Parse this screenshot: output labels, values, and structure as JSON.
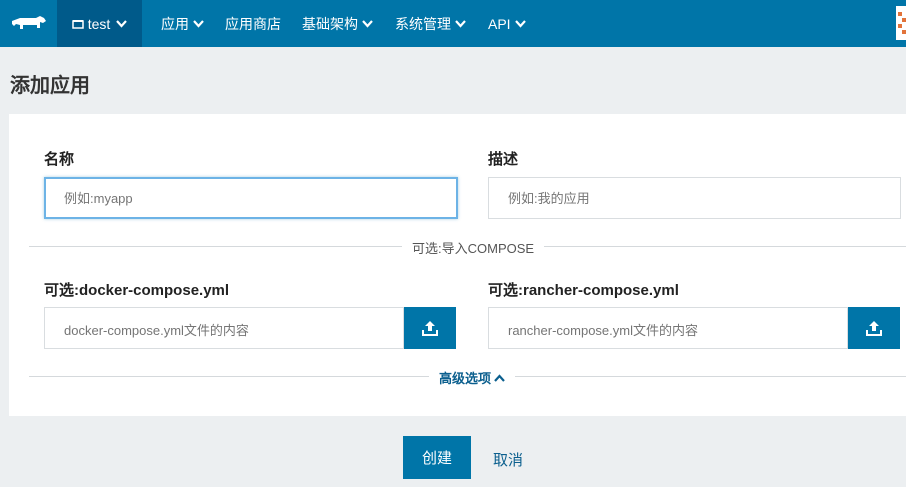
{
  "nav": {
    "environment": "test",
    "items": [
      {
        "label": "应用",
        "has_dropdown": true
      },
      {
        "label": "应用商店",
        "has_dropdown": false
      },
      {
        "label": "基础架构",
        "has_dropdown": true
      },
      {
        "label": "系统管理",
        "has_dropdown": true
      },
      {
        "label": "API",
        "has_dropdown": true
      }
    ]
  },
  "page": {
    "title": "添加应用"
  },
  "form": {
    "name_label": "名称",
    "name_placeholder": "例如:myapp",
    "desc_label": "描述",
    "desc_placeholder": "例如:我的应用",
    "compose_divider": "可选:导入COMPOSE",
    "docker_label": "可选:docker-compose.yml",
    "docker_placeholder": "docker-compose.yml文件的内容",
    "rancher_label": "可选:rancher-compose.yml",
    "rancher_placeholder": "rancher-compose.yml文件的内容",
    "advanced_label": "高级选项"
  },
  "actions": {
    "create_label": "创建",
    "cancel_label": "取消"
  },
  "colors": {
    "nav_bg": "#0075a8",
    "nav_active": "#005a8a",
    "primary": "#0075a8",
    "page_bg": "#eceff1"
  }
}
